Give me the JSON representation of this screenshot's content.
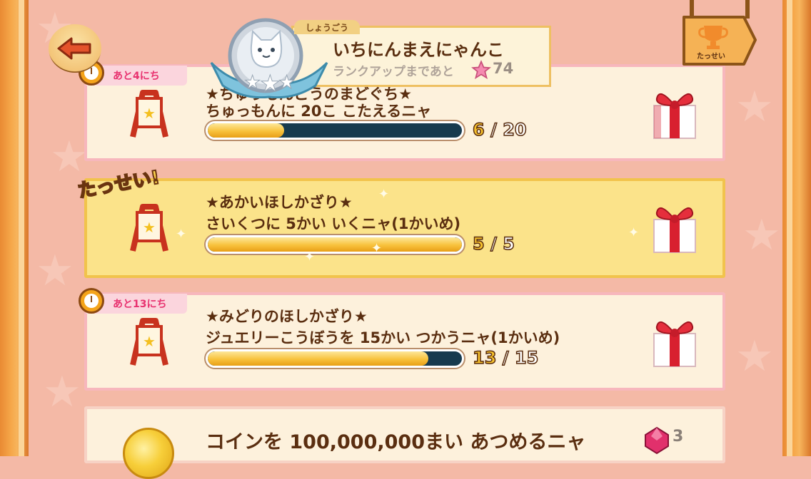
{
  "header": {
    "back_label": "",
    "rank_tab": "しょうごう",
    "rank_title": "いちにんまえにゃんこ",
    "rank_sub": "ランクアップまであと",
    "rank_points": "74",
    "achievement_label": "たっせい"
  },
  "missions": [
    {
      "tag": "あと4にち",
      "title": "★ちゅうもんごうのまどぐち★",
      "desc": "ちゅっもんに 20こ こたえるニャ",
      "current": "6",
      "total": "20",
      "progress": 0.3,
      "status": "active"
    },
    {
      "tag": "",
      "done_label": "たっせい!",
      "title": "★あかいほしかざり★",
      "desc": "さいくつに 5かい いくニャ(1かいめ)",
      "current": "5",
      "total": "5",
      "progress": 1.0,
      "status": "complete"
    },
    {
      "tag": "あと13にち",
      "title": "★みどりのほしかざり★",
      "desc": "ジュエリーこうぼうを 15かい つかうニャ(1かいめ)",
      "current": "13",
      "total": "15",
      "progress": 0.8667,
      "status": "active"
    },
    {
      "title": "コインを 100,000,000まい あつめるニャ",
      "reward_count": "3",
      "status": "active"
    }
  ],
  "separator": "/",
  "colors": {
    "tag_text": "#e8316f",
    "title_text": "#5a2e10",
    "bar_fill": "#f8c23c",
    "bar_track": "#173a4e"
  }
}
